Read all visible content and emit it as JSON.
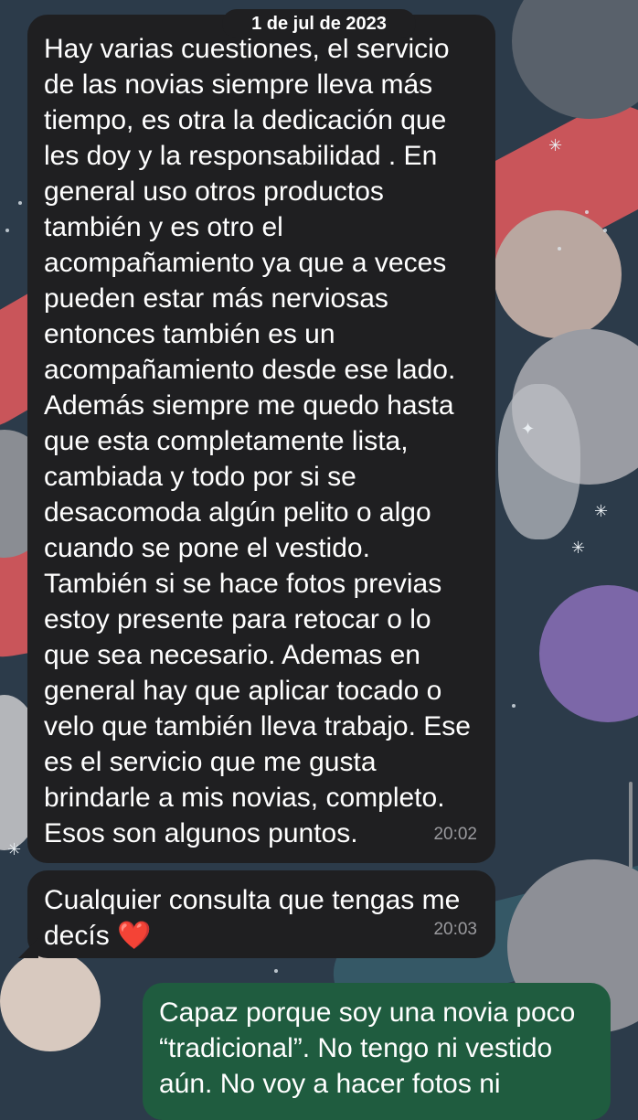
{
  "chat": {
    "date_chip": "1 de jul de 2023",
    "messages": [
      {
        "direction": "incoming",
        "text": "Hay varias cuestiones, el servicio\nde las novias siempre lleva más\ntiempo, es otra la dedicación que\nles doy y la responsabilidad . En\ngeneral uso otros productos\ntambién y es otro el\nacompañamiento ya que a veces\npueden estar más nerviosas\nentonces también es un\nacompañamiento desde ese lado.\nAdemás siempre me quedo hasta\nque esta completamente lista,\ncambiada y todo por si se\ndesacomoda algún pelito o algo\ncuando se pone el vestido.\nTambién si se hace fotos previas\nestoy presente para retocar o lo\nque sea necesario. Ademas en\ngeneral hay que aplicar tocado o\nvelo que también lleva trabajo. Ese\nes el servicio que me gusta\nbrindarle a mis novias, completo.\nEsos son algunos puntos.",
        "time": "20:02"
      },
      {
        "direction": "incoming",
        "text": "Cualquier consulta que tengas me\ndecís ❤️",
        "time": "20:03"
      },
      {
        "direction": "outgoing",
        "text": "Capaz porque soy una novia poco\n“tradicional”. No tengo ni vestido\naún. No voy a hacer fotos ni"
      }
    ]
  },
  "colors": {
    "incoming_bubble": "#1f1f21",
    "outgoing_bubble": "#1f5c3f",
    "timestamp": "#9a9a9e",
    "wallpaper_base": "#2c3b4a"
  }
}
